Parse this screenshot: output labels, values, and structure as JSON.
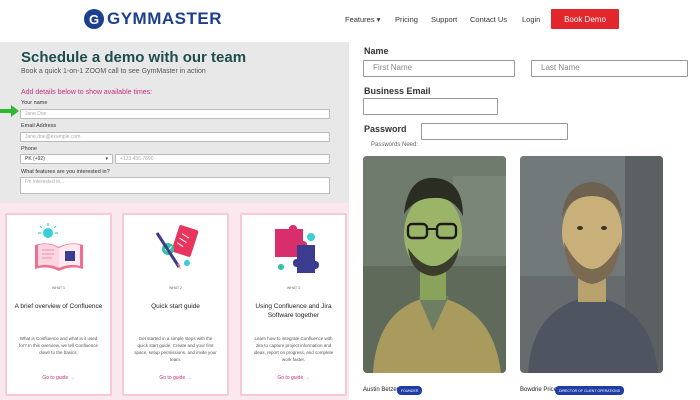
{
  "nav": {
    "logo_text": "GYMMASTER",
    "logo_mark": "G",
    "links": [
      "Features ▾",
      "Pricing",
      "Support",
      "Contact Us",
      "Login"
    ],
    "cta": "Book Demo"
  },
  "form": {
    "title": "Schedule a demo with our team",
    "subtitle": "Book a quick 1-on-1 ZOOM call to see GymMaster in action",
    "add_details": "Add details below to show available times:",
    "name_label": "Your name",
    "name_placeholder": "Jane Doe",
    "email_label": "Email Address",
    "email_placeholder": "Jane.doe@example.com",
    "phone_label": "Phone",
    "country_value": "PK (+92)",
    "phone_placeholder": "+123 456 7890",
    "features_label": "What features are you interested in?",
    "features_placeholder": "I'm interested in..."
  },
  "cards": [
    {
      "tag": "WHAT 1",
      "title": "A brief overview of Confluence",
      "desc": "What is Confluence and what is it used for? In this overview, we tell Confluence down to the basics.",
      "link": "Go to guide →"
    },
    {
      "tag": "WHAT 2",
      "title": "Quick start guide",
      "desc": "Get started in a simple steps with the quick start guide. Create and your first space, setup permissions, and invite your team.",
      "link": "Go to guide →"
    },
    {
      "tag": "WHAT 3",
      "title": "Using Confluence and Jira Software together",
      "desc": "Learn how to integrate Confluence with Jira to capture project information and ideas, report on progress, and complete work faster.",
      "link": "Go to guide →"
    }
  ],
  "right": {
    "name_label": "Name",
    "first_name_placeholder": "First Name",
    "last_name_placeholder": "Last Name",
    "business_email_label": "Business Email",
    "password_label": "Password",
    "password_hint": "Passwords Need:"
  },
  "people": [
    {
      "name": "Austin Betzer",
      "badge": "FOUNDER"
    },
    {
      "name": "Bowdrie Price",
      "badge": "DIRECTOR OF CLIENT OPERATIONS"
    }
  ],
  "colors": {
    "brand": "#1d3f8f",
    "cta": "#e3262b",
    "accent": "#c3307f",
    "title": "#1e4d4d",
    "badge": "#1e3ea6"
  }
}
